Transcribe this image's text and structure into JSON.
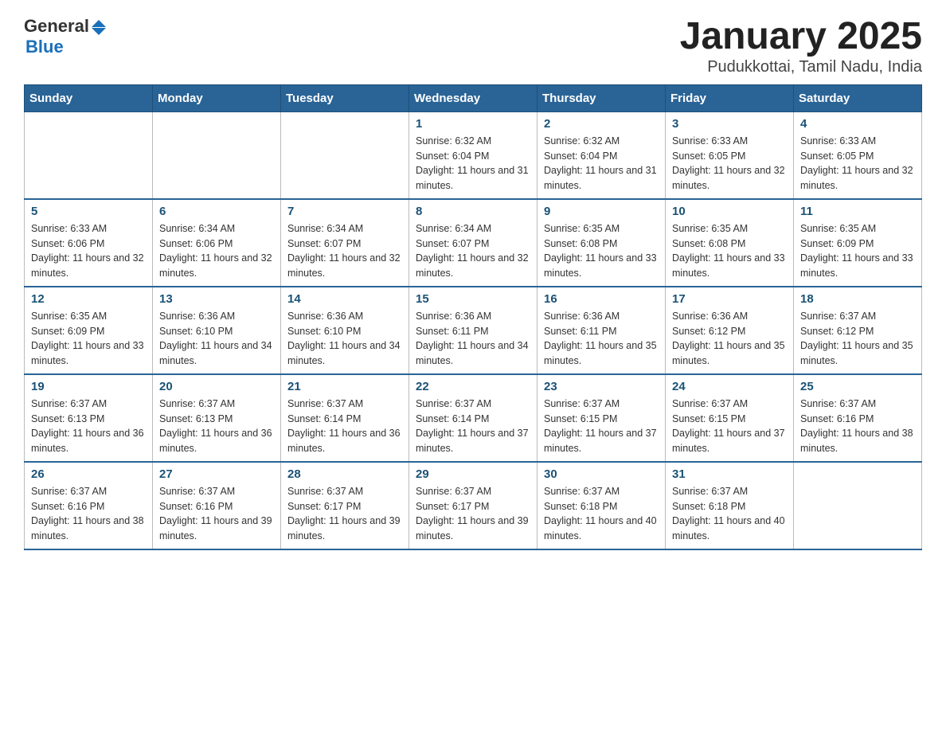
{
  "header": {
    "logo_general": "General",
    "logo_blue": "Blue",
    "title": "January 2025",
    "subtitle": "Pudukkottai, Tamil Nadu, India"
  },
  "days_of_week": [
    "Sunday",
    "Monday",
    "Tuesday",
    "Wednesday",
    "Thursday",
    "Friday",
    "Saturday"
  ],
  "weeks": [
    [
      {
        "day": "",
        "info": ""
      },
      {
        "day": "",
        "info": ""
      },
      {
        "day": "",
        "info": ""
      },
      {
        "day": "1",
        "info": "Sunrise: 6:32 AM\nSunset: 6:04 PM\nDaylight: 11 hours and 31 minutes."
      },
      {
        "day": "2",
        "info": "Sunrise: 6:32 AM\nSunset: 6:04 PM\nDaylight: 11 hours and 31 minutes."
      },
      {
        "day": "3",
        "info": "Sunrise: 6:33 AM\nSunset: 6:05 PM\nDaylight: 11 hours and 32 minutes."
      },
      {
        "day": "4",
        "info": "Sunrise: 6:33 AM\nSunset: 6:05 PM\nDaylight: 11 hours and 32 minutes."
      }
    ],
    [
      {
        "day": "5",
        "info": "Sunrise: 6:33 AM\nSunset: 6:06 PM\nDaylight: 11 hours and 32 minutes."
      },
      {
        "day": "6",
        "info": "Sunrise: 6:34 AM\nSunset: 6:06 PM\nDaylight: 11 hours and 32 minutes."
      },
      {
        "day": "7",
        "info": "Sunrise: 6:34 AM\nSunset: 6:07 PM\nDaylight: 11 hours and 32 minutes."
      },
      {
        "day": "8",
        "info": "Sunrise: 6:34 AM\nSunset: 6:07 PM\nDaylight: 11 hours and 32 minutes."
      },
      {
        "day": "9",
        "info": "Sunrise: 6:35 AM\nSunset: 6:08 PM\nDaylight: 11 hours and 33 minutes."
      },
      {
        "day": "10",
        "info": "Sunrise: 6:35 AM\nSunset: 6:08 PM\nDaylight: 11 hours and 33 minutes."
      },
      {
        "day": "11",
        "info": "Sunrise: 6:35 AM\nSunset: 6:09 PM\nDaylight: 11 hours and 33 minutes."
      }
    ],
    [
      {
        "day": "12",
        "info": "Sunrise: 6:35 AM\nSunset: 6:09 PM\nDaylight: 11 hours and 33 minutes."
      },
      {
        "day": "13",
        "info": "Sunrise: 6:36 AM\nSunset: 6:10 PM\nDaylight: 11 hours and 34 minutes."
      },
      {
        "day": "14",
        "info": "Sunrise: 6:36 AM\nSunset: 6:10 PM\nDaylight: 11 hours and 34 minutes."
      },
      {
        "day": "15",
        "info": "Sunrise: 6:36 AM\nSunset: 6:11 PM\nDaylight: 11 hours and 34 minutes."
      },
      {
        "day": "16",
        "info": "Sunrise: 6:36 AM\nSunset: 6:11 PM\nDaylight: 11 hours and 35 minutes."
      },
      {
        "day": "17",
        "info": "Sunrise: 6:36 AM\nSunset: 6:12 PM\nDaylight: 11 hours and 35 minutes."
      },
      {
        "day": "18",
        "info": "Sunrise: 6:37 AM\nSunset: 6:12 PM\nDaylight: 11 hours and 35 minutes."
      }
    ],
    [
      {
        "day": "19",
        "info": "Sunrise: 6:37 AM\nSunset: 6:13 PM\nDaylight: 11 hours and 36 minutes."
      },
      {
        "day": "20",
        "info": "Sunrise: 6:37 AM\nSunset: 6:13 PM\nDaylight: 11 hours and 36 minutes."
      },
      {
        "day": "21",
        "info": "Sunrise: 6:37 AM\nSunset: 6:14 PM\nDaylight: 11 hours and 36 minutes."
      },
      {
        "day": "22",
        "info": "Sunrise: 6:37 AM\nSunset: 6:14 PM\nDaylight: 11 hours and 37 minutes."
      },
      {
        "day": "23",
        "info": "Sunrise: 6:37 AM\nSunset: 6:15 PM\nDaylight: 11 hours and 37 minutes."
      },
      {
        "day": "24",
        "info": "Sunrise: 6:37 AM\nSunset: 6:15 PM\nDaylight: 11 hours and 37 minutes."
      },
      {
        "day": "25",
        "info": "Sunrise: 6:37 AM\nSunset: 6:16 PM\nDaylight: 11 hours and 38 minutes."
      }
    ],
    [
      {
        "day": "26",
        "info": "Sunrise: 6:37 AM\nSunset: 6:16 PM\nDaylight: 11 hours and 38 minutes."
      },
      {
        "day": "27",
        "info": "Sunrise: 6:37 AM\nSunset: 6:16 PM\nDaylight: 11 hours and 39 minutes."
      },
      {
        "day": "28",
        "info": "Sunrise: 6:37 AM\nSunset: 6:17 PM\nDaylight: 11 hours and 39 minutes."
      },
      {
        "day": "29",
        "info": "Sunrise: 6:37 AM\nSunset: 6:17 PM\nDaylight: 11 hours and 39 minutes."
      },
      {
        "day": "30",
        "info": "Sunrise: 6:37 AM\nSunset: 6:18 PM\nDaylight: 11 hours and 40 minutes."
      },
      {
        "day": "31",
        "info": "Sunrise: 6:37 AM\nSunset: 6:18 PM\nDaylight: 11 hours and 40 minutes."
      },
      {
        "day": "",
        "info": ""
      }
    ]
  ]
}
